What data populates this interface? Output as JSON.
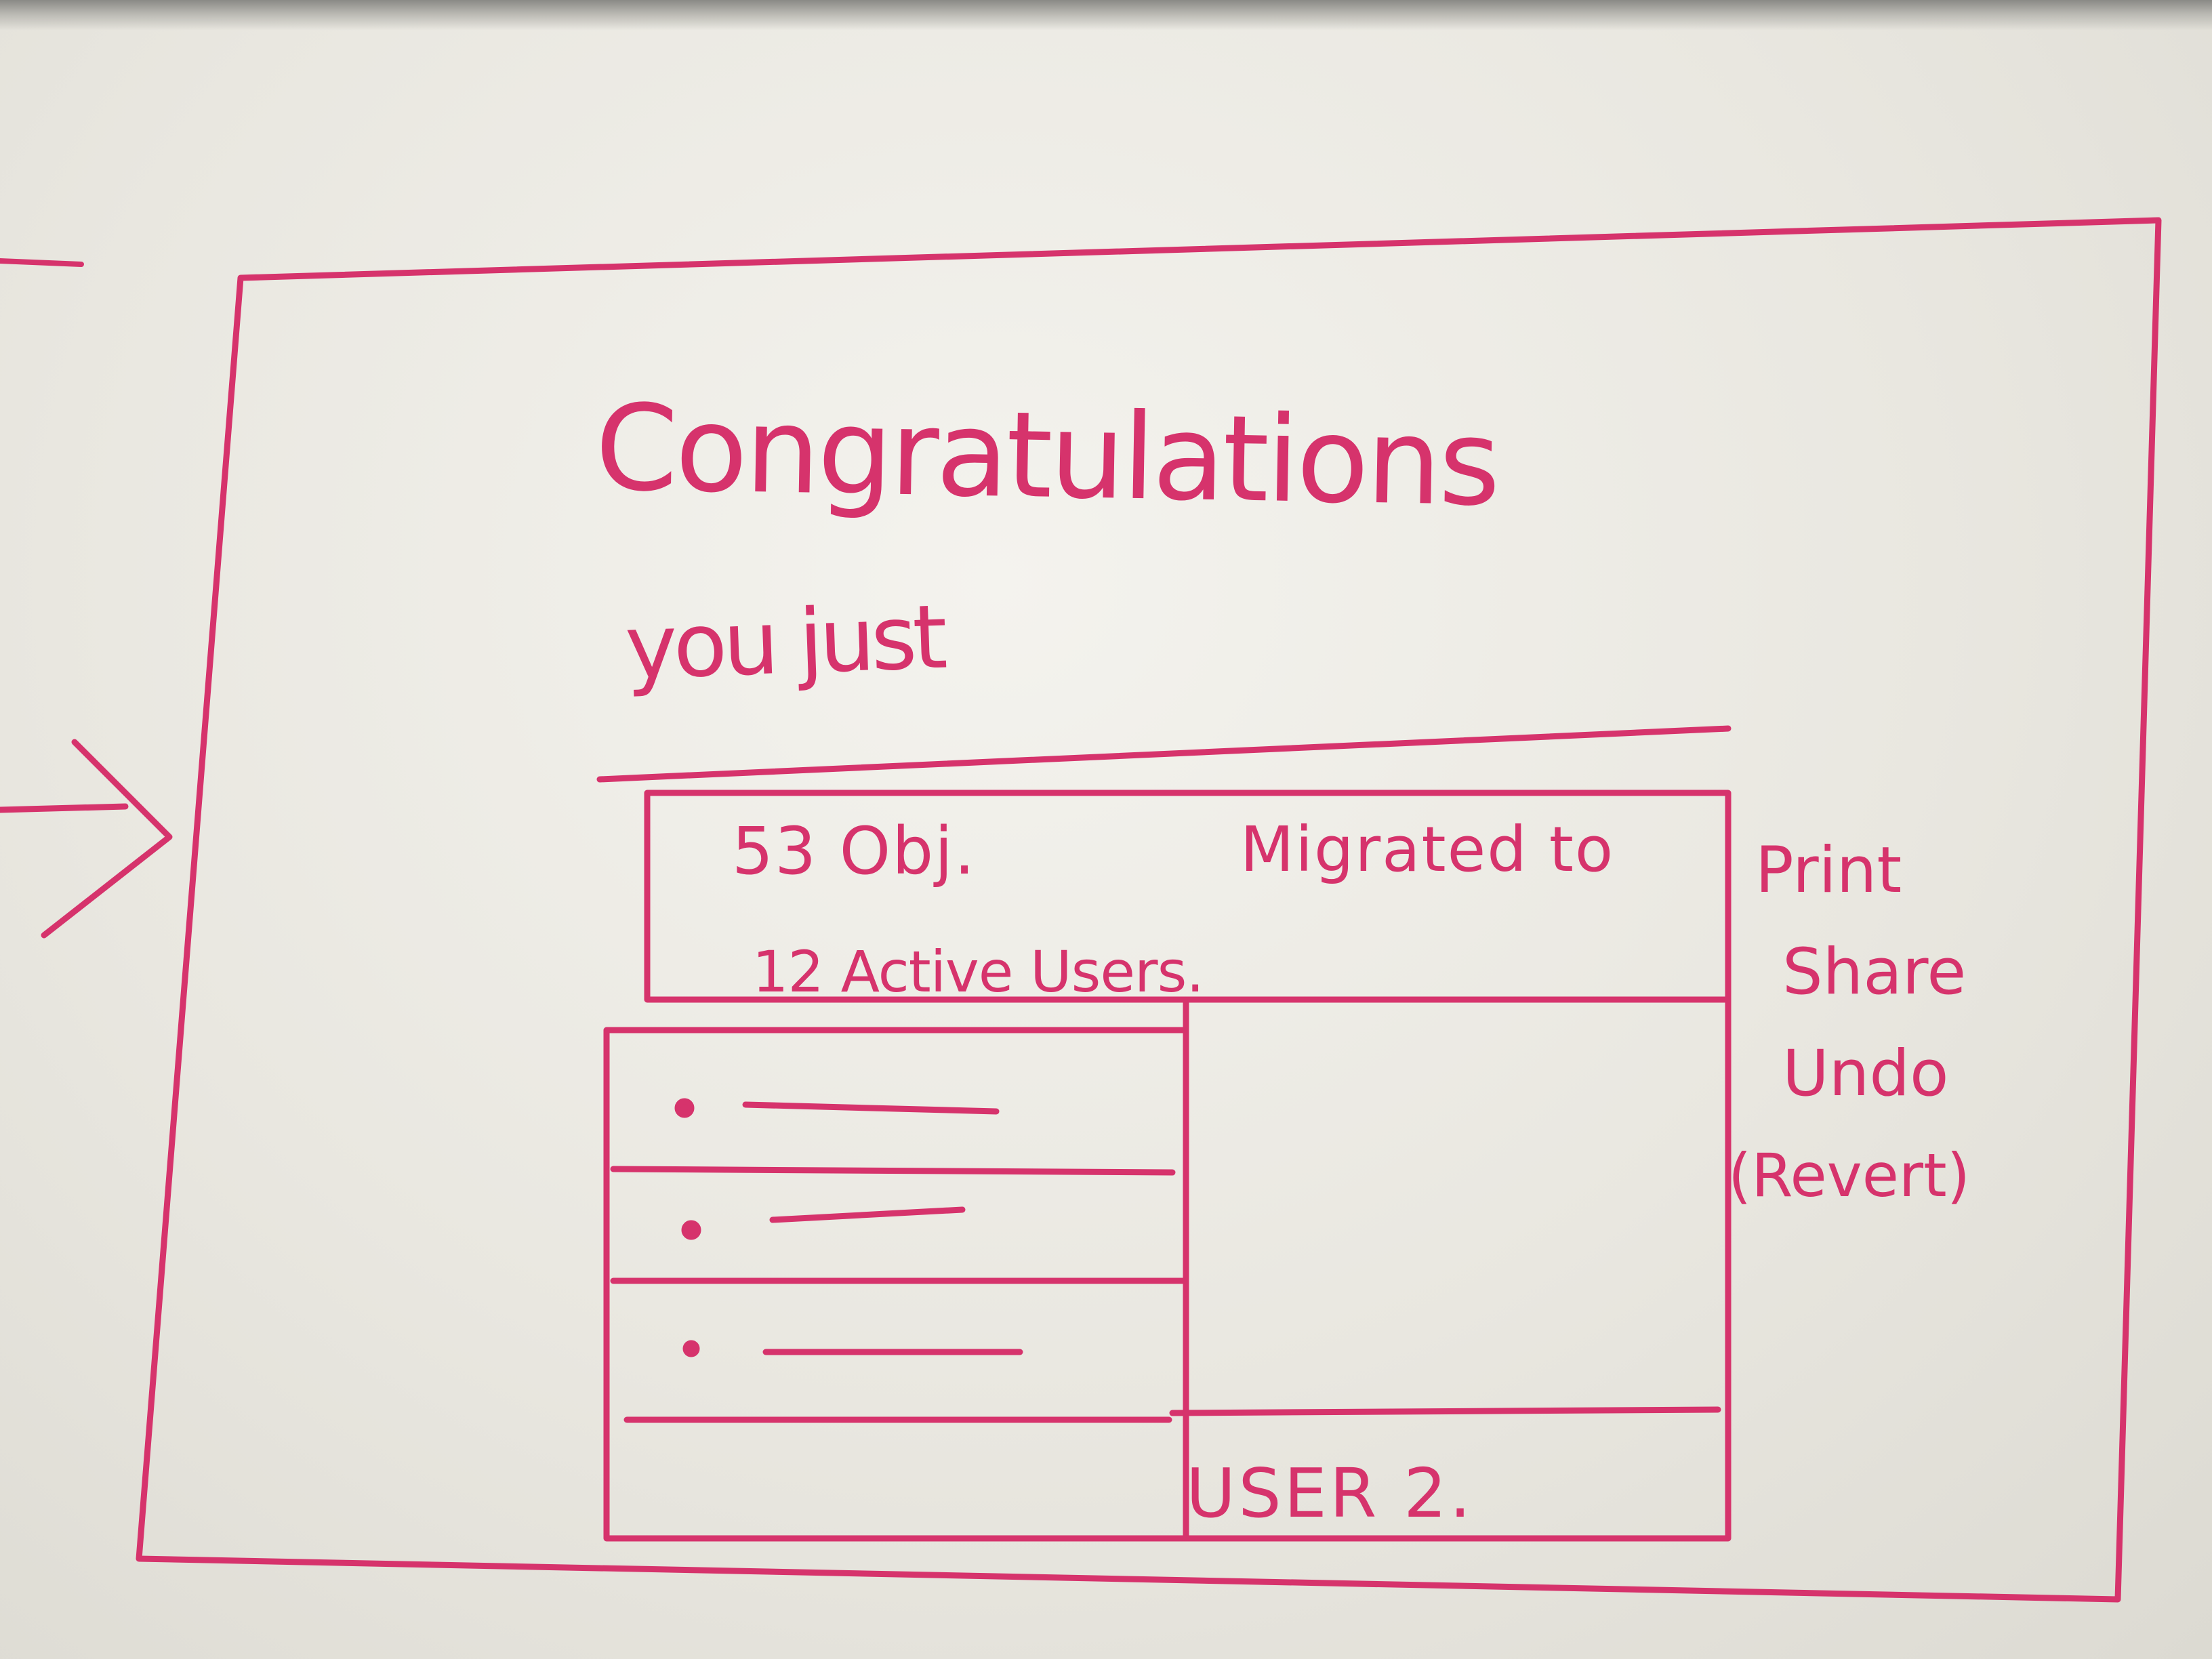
{
  "heading": {
    "line1": "Congratulations",
    "line2": "you just"
  },
  "summary": {
    "objects": "53 Obj.",
    "migrated": "Migrated to",
    "users": "12 Active Users."
  },
  "details": {
    "selected_user": "USER 2."
  },
  "actions": [
    {
      "label": "Print"
    },
    {
      "label": "Share"
    },
    {
      "label": "Undo"
    },
    {
      "label": "(Revert)"
    }
  ],
  "colors": {
    "marker": "#d6336c",
    "board": "#eeede8"
  }
}
